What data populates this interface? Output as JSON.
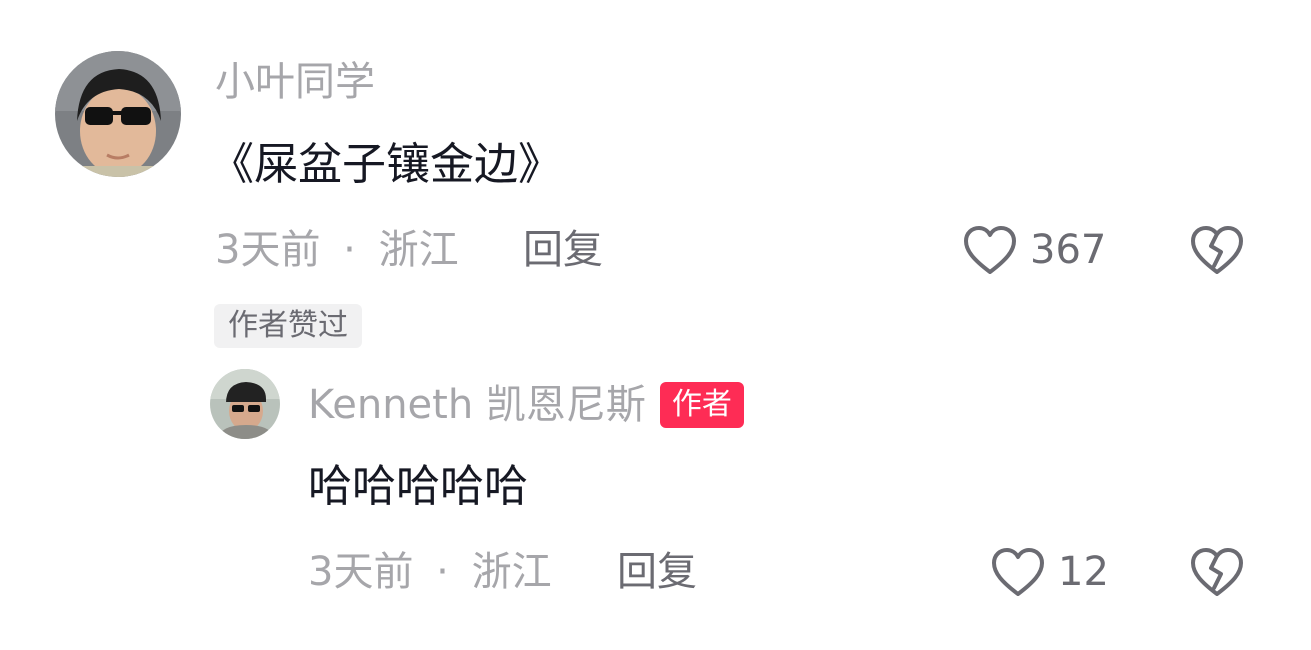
{
  "comment": {
    "username": "小叶同学",
    "text": "《屎盆子镶金边》",
    "time": "3天前",
    "separator": "·",
    "location": "浙江",
    "reply_label": "回复",
    "like_count": "367",
    "author_liked_badge": "作者赞过",
    "icons": {
      "avatar": "avatar-photo",
      "like": "heart-outline-icon",
      "dislike": "broken-heart-icon"
    }
  },
  "reply": {
    "username": "Kenneth 凯恩尼斯",
    "author_tag": "作者",
    "text": "哈哈哈哈哈",
    "time": "3天前",
    "separator": "·",
    "location": "浙江",
    "reply_label": "回复",
    "like_count": "12",
    "icons": {
      "avatar": "avatar-photo",
      "like": "heart-outline-icon",
      "dislike": "broken-heart-icon"
    }
  },
  "colors": {
    "muted_text": "#a6a6aa",
    "primary_text": "#161823",
    "action_text": "#6b6b72",
    "author_tag_bg": "#fe2c55",
    "badge_bg": "#f1f1f2"
  }
}
